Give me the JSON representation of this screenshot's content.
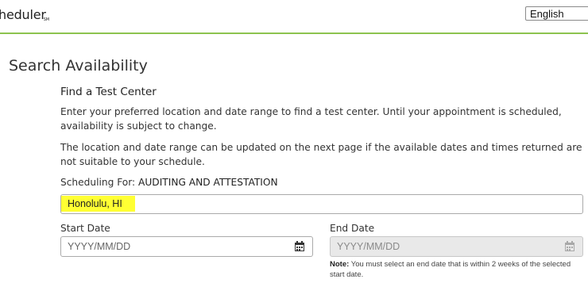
{
  "header": {
    "brand": "heduler",
    "brand_mark": "SM",
    "language": "English"
  },
  "page": {
    "title": "Search Availability",
    "subtitle": "Find a Test Center",
    "intro": "Enter your preferred location and date range to find a test center. Until your appointment is scheduled, availability is subject to change.",
    "update_note": "The location and date range can be updated on the next page if the available dates and times returned are not suitable to your schedule."
  },
  "scheduling": {
    "label": "Scheduling For:",
    "exam": "AUDITING AND ATTESTATION"
  },
  "location": {
    "value": "Honolulu, HI",
    "highlight_color": "#ffff33"
  },
  "start_date": {
    "label": "Start Date",
    "placeholder": "YYYY/MM/DD"
  },
  "end_date": {
    "label": "End Date",
    "placeholder": "YYYY/MM/DD",
    "note_label": "Note:",
    "note_text": " You must select an end date that is within 2 weeks of the selected start date."
  },
  "colors": {
    "accent_line": "#8cc34f",
    "disabled_field": "#e9e9e9"
  }
}
